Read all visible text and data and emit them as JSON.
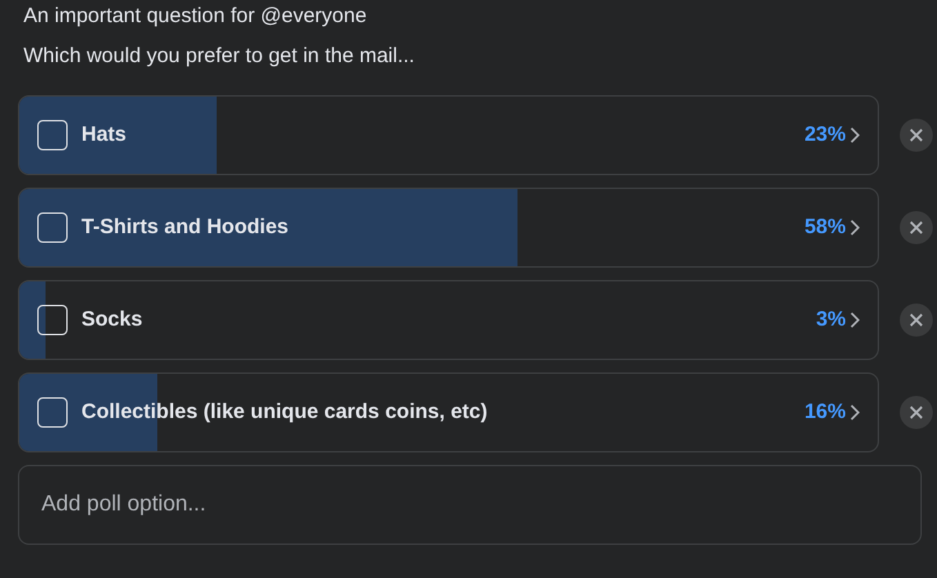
{
  "title": "An important question for @everyone",
  "question": "Which would you prefer to get in the mail...",
  "options": [
    {
      "label": "Hats",
      "checked": false,
      "level": 0.23,
      "percent": "23%"
    },
    {
      "label": "T-Shirts and Hoodies",
      "checked": false,
      "level": 0.58,
      "percent": "58%"
    },
    {
      "label": "Socks",
      "checked": false,
      "level": 0.03,
      "percent": "3%"
    },
    {
      "label": "Collectibles (like unique cards coins, etc)",
      "checked": false,
      "level": 0.16,
      "percent": "16%"
    }
  ],
  "add_option": {
    "placeholder": "Add poll option..."
  }
}
